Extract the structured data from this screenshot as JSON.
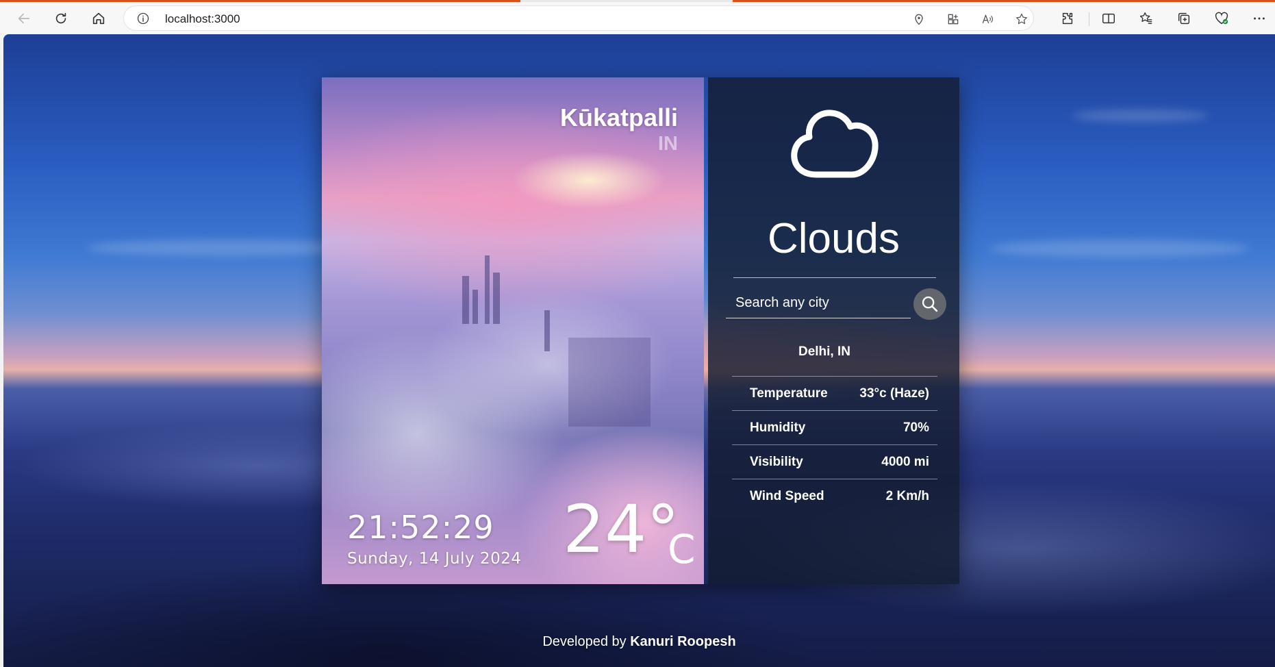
{
  "browser": {
    "url": "localhost:3000",
    "accent_color": "#d9531e",
    "icons": [
      "back-icon",
      "refresh-icon",
      "home-icon",
      "info-icon",
      "location-icon",
      "apps-icon",
      "read-aloud-icon",
      "favorite-star-icon",
      "extensions-icon",
      "split-screen-icon",
      "favorites-icon",
      "collections-icon",
      "browser-essentials-icon",
      "more-icon"
    ]
  },
  "weather": {
    "location": {
      "city": "Kūkatpalli",
      "country": "IN"
    },
    "time": "21:52:29",
    "date": "Sunday, 14 July 2024",
    "temperature": "24°",
    "unit": "C",
    "condition": "Clouds",
    "condition_icon": "cloud-icon",
    "search": {
      "placeholder": "Search any city"
    },
    "result": {
      "city": "Delhi, IN",
      "rows": [
        {
          "label": "Temperature",
          "value": "33°c (Haze)"
        },
        {
          "label": "Humidity",
          "value": "70%"
        },
        {
          "label": "Visibility",
          "value": "4000 mi"
        },
        {
          "label": "Wind Speed",
          "value": "2 Km/h"
        }
      ]
    }
  },
  "footer": {
    "prefix": "Developed by",
    "author": "Kanuri Roopesh"
  }
}
